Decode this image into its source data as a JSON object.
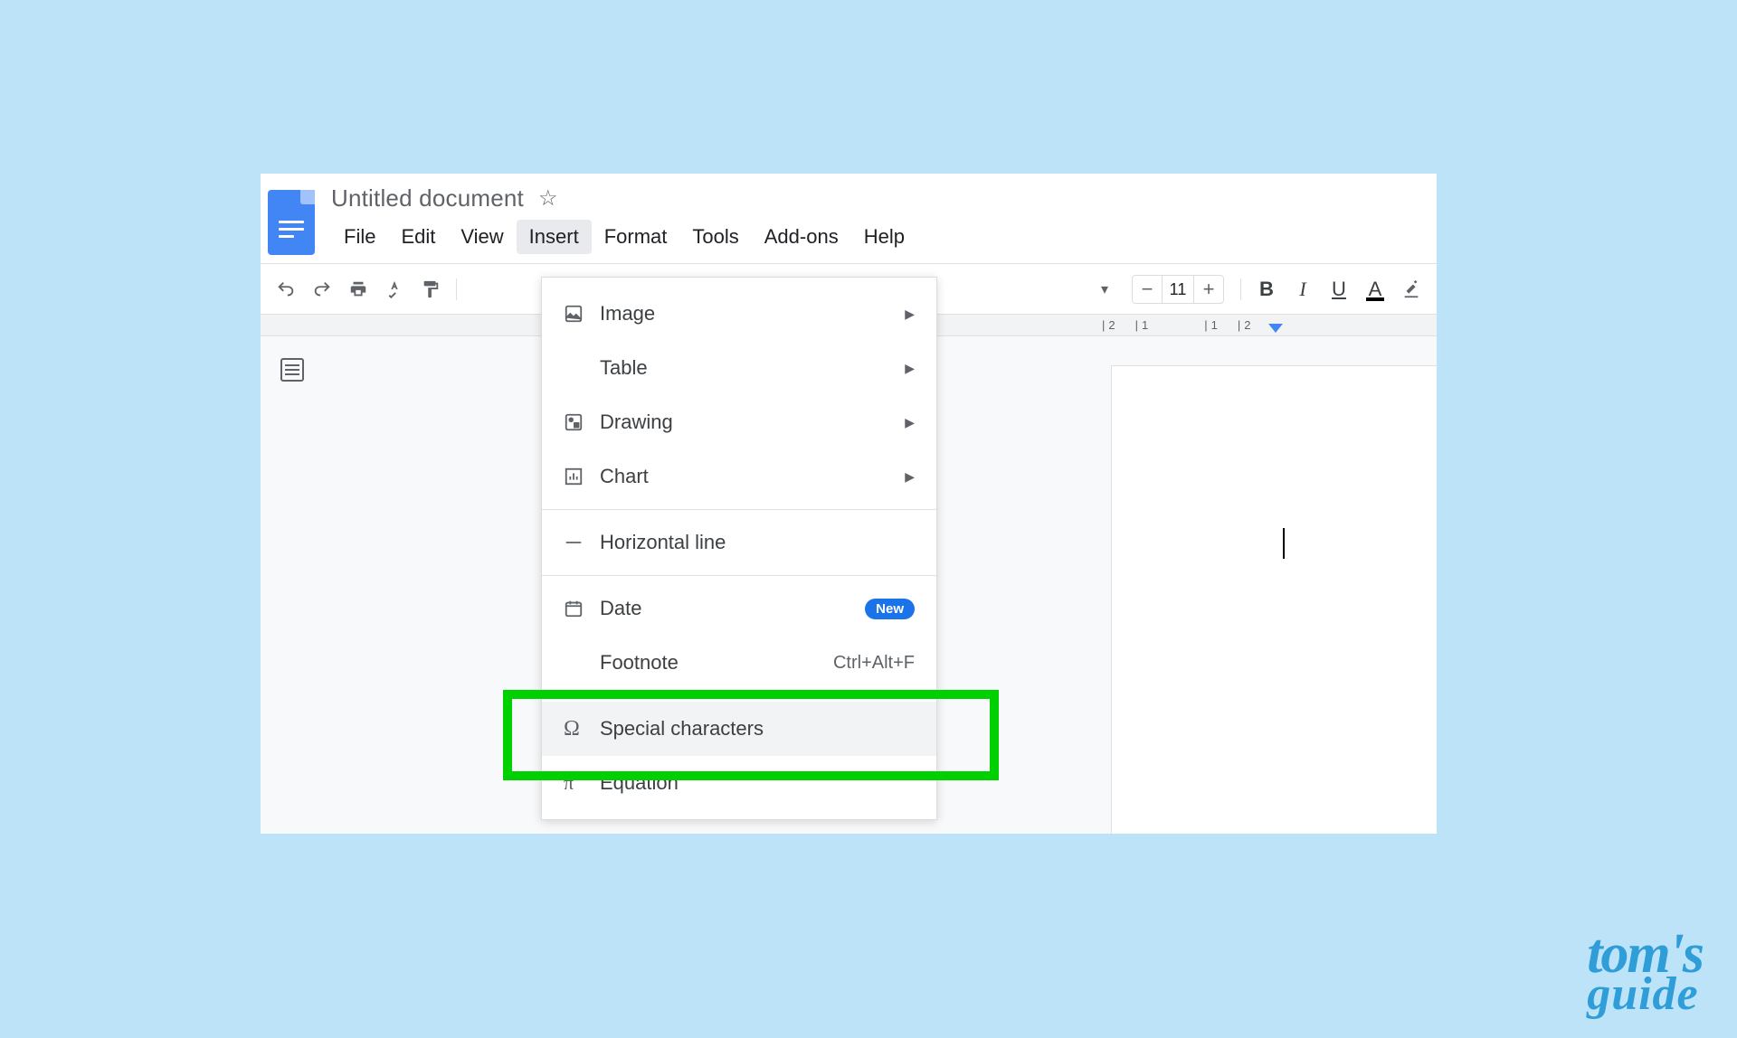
{
  "header": {
    "doc_title": "Untitled document",
    "menu": [
      "File",
      "Edit",
      "View",
      "Insert",
      "Format",
      "Tools",
      "Add-ons",
      "Help"
    ],
    "active_menu_index": 3
  },
  "toolbar": {
    "font_size": "11"
  },
  "dropdown": {
    "items": [
      {
        "label": "Image",
        "icon": "image-icon",
        "submenu": true
      },
      {
        "label": "Table",
        "icon": "",
        "submenu": true
      },
      {
        "label": "Drawing",
        "icon": "drawing-icon",
        "submenu": true
      },
      {
        "label": "Chart",
        "icon": "chart-icon",
        "submenu": true
      },
      {
        "label": "Horizontal line",
        "icon": "hline-icon",
        "submenu": false,
        "sep_before": true
      },
      {
        "label": "Date",
        "icon": "date-icon",
        "badge": "New",
        "sep_before": true
      },
      {
        "label": "Footnote",
        "icon": "",
        "shortcut": "Ctrl+Alt+F"
      },
      {
        "label": "Special characters",
        "icon": "omega-icon",
        "highlighted": true,
        "sep_before": true
      },
      {
        "label": "Equation",
        "icon": "pi-icon"
      }
    ]
  },
  "ruler": {
    "ticks": [
      "2",
      "1",
      "1",
      "2"
    ]
  },
  "watermark": {
    "line1": "tom's",
    "line2": "guide"
  }
}
